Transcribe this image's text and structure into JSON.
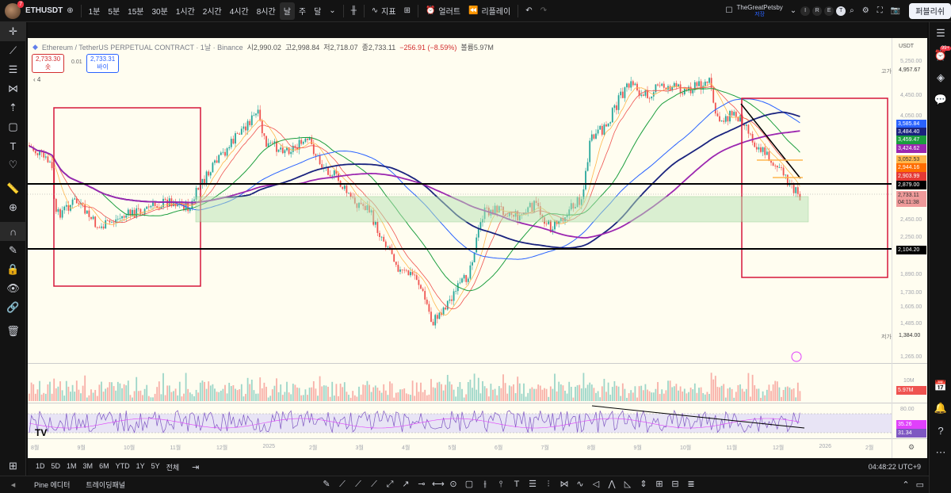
{
  "header": {
    "avatar_badge": "7",
    "symbol": "ETHUSDT",
    "intervals": [
      "1분",
      "5분",
      "15분",
      "30분",
      "1시간",
      "2시간",
      "4시간",
      "8시간",
      "날",
      "주",
      "달"
    ],
    "active_interval": "날",
    "indicators_label": "지표",
    "alert_label": "얼러트",
    "replay_label": "리플레이",
    "layout_name": "TheGreatPetsby",
    "layout_subtitle": "저장",
    "shortcuts": [
      "I",
      "R",
      "E",
      "T"
    ],
    "publish_label": "퍼블리쉬"
  },
  "legend": {
    "title": "Ethereum / TetherUS PERPETUAL CONTRACT · 1날 · Binance",
    "open": "시2,990.02",
    "high": "고2,998.84",
    "low": "저2,718.07",
    "close": "종2,733.11",
    "change": "−256.91 (−8.59%)",
    "volume": "볼륨5.97M",
    "sell_price": "2,733.30",
    "sell_label": "숏",
    "spread": "0.01",
    "buy_price": "2,733.31",
    "buy_label": "바이",
    "indicator_count": "4"
  },
  "price_axis": {
    "currency": "USDT",
    "labels": [
      "5,250.00",
      "4,450.00",
      "4,050.00",
      "2,450.00",
      "2,250.00",
      "1,890.00",
      "1,730.00",
      "1,605.00",
      "1,485.00",
      "1,265.00"
    ],
    "high_label": "고가",
    "high_value": "4,957.67",
    "low_label": "저가",
    "low_value": "1,384.00"
  },
  "price_tags": [
    {
      "value": "3,585.84",
      "color": "#2962ff"
    },
    {
      "value": "3,484.40",
      "color": "#1a237e"
    },
    {
      "value": "3,459.47",
      "color": "#1b9e3e"
    },
    {
      "value": "3,424.62",
      "color": "#9c27b0"
    },
    {
      "value": "3,052.53",
      "color": "#ffb74d"
    },
    {
      "value": "2,944.16",
      "color": "#ff6d00"
    },
    {
      "value": "2,903.99",
      "color": "#e53935"
    },
    {
      "value": "2,879.00",
      "color": "#000000"
    },
    {
      "value": "2,733.11",
      "color": "#ef9a9a"
    },
    {
      "value": "04:11:38",
      "color": "#ef9a9a"
    },
    {
      "value": "2,104.20",
      "color": "#000000"
    }
  ],
  "volume_axis": {
    "label": "10M",
    "value": "5.97M"
  },
  "rsi_axis": {
    "top": "80.00",
    "rsi": "35.26",
    "ma": "31.34"
  },
  "time_axis": [
    "8월",
    "9월",
    "10월",
    "11월",
    "12월",
    "2025",
    "2월",
    "3월",
    "4월",
    "5월",
    "6월",
    "7월",
    "8월",
    "9월",
    "10월",
    "11월",
    "12월",
    "2026",
    "2월"
  ],
  "ranges": [
    "1D",
    "5D",
    "1M",
    "3M",
    "6M",
    "YTD",
    "1Y",
    "5Y",
    "전체"
  ],
  "clock": "04:48:22 UTC+9",
  "footer_tabs": [
    "Pine 에디터",
    "트레이딩패널"
  ],
  "colors": {
    "bg": "#fffdf0",
    "up": "#26a69a",
    "down": "#ef5350",
    "box": "#d6163b",
    "zone": "#b6e3b3"
  },
  "right_badge": "99+"
}
